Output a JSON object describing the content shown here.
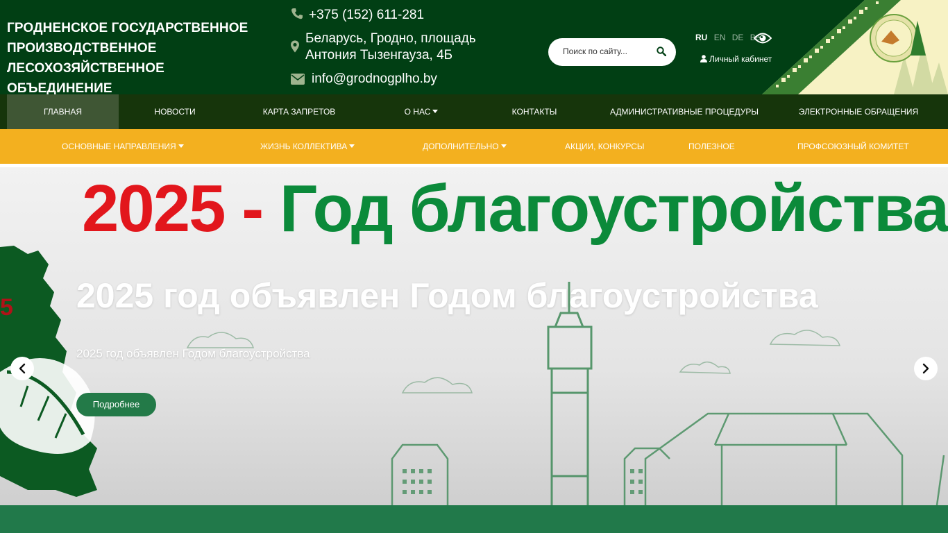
{
  "header": {
    "org_title": "ГРОДНЕНСКОЕ ГОСУДАРСТВЕННОЕ ПРОИЗВОДСТВЕННОЕ ЛЕСОХОЗЯЙСТВЕННОЕ ОБЪЕДИНЕНИЕ",
    "phone": "+375 (152) 611-281",
    "address": "Беларусь, Гродно, площадь Антония Тызенгауза, 4Б",
    "email": "info@grodnogplho.by",
    "search_placeholder": "Поиск по сайту...",
    "languages": [
      "RU",
      "EN",
      "DE",
      "Be"
    ],
    "active_language": "RU",
    "cabinet_label": "Личный кабинет"
  },
  "nav_main": [
    {
      "label": "ГЛАВНАЯ"
    },
    {
      "label": "НОВОСТИ"
    },
    {
      "label": "КАРТА ЗАПРЕТОВ"
    },
    {
      "label": "О НАС"
    },
    {
      "label": "КОНТАКТЫ"
    },
    {
      "label": "АДМИНИСТРАТИВНЫЕ ПРОЦЕДУРЫ"
    },
    {
      "label": "ЭЛЕКТРОННЫЕ ОБРАЩЕНИЯ"
    }
  ],
  "nav_secondary": [
    {
      "label": "ОСНОВНЫЕ НАПРАВЛЕНИЯ"
    },
    {
      "label": "ЖИЗНЬ КОЛЛЕКТИВА"
    },
    {
      "label": "ДОПОЛНИТЕЛЬНО"
    },
    {
      "label": "АКЦИИ, КОНКУРСЫ"
    },
    {
      "label": "ПОЛЕЗНОЕ"
    },
    {
      "label": "ПРОФСОЮЗНЫЙ КОМИТЕТ"
    }
  ],
  "slider": {
    "banner_year": "2025 -",
    "banner_text": "Год благоустройства ст",
    "title": "2025 год объявлен Годом благоустройства",
    "subtitle": "2025 год объявлен Годом благоустройства",
    "button_label": "Подробнее",
    "badge_digit": "5"
  },
  "colors": {
    "header_bg": "#013f14",
    "nav_main_bg": "#16350b",
    "nav_active_bg": "#3f5634",
    "nav_secondary_bg": "#f3b01f",
    "accent_green": "#237a48",
    "banner_red": "#e2161c",
    "banner_green": "#0b8a3a"
  }
}
